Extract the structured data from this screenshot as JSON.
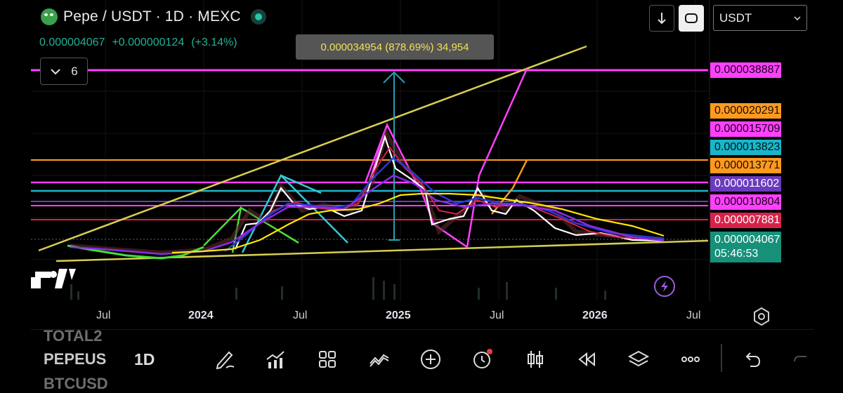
{
  "header": {
    "symbol_title": "Pepe / USDT · 1D · MEXC",
    "last_price": "0.000004067",
    "change_abs": "+0.000000124",
    "change_pct": "(+3.14%)"
  },
  "measure_label": "0.000034954 (878.69%) 34,954",
  "indicators_toggle": {
    "count": "6"
  },
  "quote_select": {
    "value": "USDT"
  },
  "price_labels": [
    {
      "text": "0.000038887",
      "bg": "#ff40ff",
      "fg": "#1a001a"
    },
    {
      "text": "0.000020291",
      "bg": "#ff9a1f",
      "fg": "#1a0d00"
    },
    {
      "text": "0.000015709",
      "bg": "#ff40ff",
      "fg": "#1a001a"
    },
    {
      "text": "0.000013823",
      "bg": "#19b6c9",
      "fg": "#001419"
    },
    {
      "text": "0.000013771",
      "bg": "#ff9a1f",
      "fg": "#1a0d00"
    },
    {
      "text": "0.000011602",
      "bg": "#6a3bbd",
      "fg": "#ffffff"
    },
    {
      "text": "0.000010804",
      "bg": "#ff40ff",
      "fg": "#1a001a"
    },
    {
      "text": "0.000007881",
      "bg": "#d9224b",
      "fg": "#ffffff"
    }
  ],
  "current_price": {
    "price": "0.000004067",
    "countdown": "05:46:53"
  },
  "x_axis": [
    {
      "label": "Jul",
      "bold": false
    },
    {
      "label": "2024",
      "bold": true
    },
    {
      "label": "Jul",
      "bold": false
    },
    {
      "label": "2025",
      "bold": true
    },
    {
      "label": "Jul",
      "bold": false
    },
    {
      "label": "2026",
      "bold": true
    },
    {
      "label": "Jul",
      "bold": false
    }
  ],
  "bottom_bar": {
    "watch_symbols": [
      "TOTAL2",
      "PEPEUS",
      "BTCUSD"
    ],
    "interval": "1D"
  },
  "icons": [
    "drawing-pen-icon",
    "indicators-icon",
    "templates-icon",
    "compare-icon",
    "add-icon",
    "alert-icon",
    "chart-type-icon",
    "replay-icon",
    "layers-icon",
    "more-icon",
    "undo-icon",
    "redo-icon"
  ],
  "colors": {
    "up": "#22b196",
    "accent_yellow": "#f0e15a",
    "magenta": "#ff40ff"
  }
}
